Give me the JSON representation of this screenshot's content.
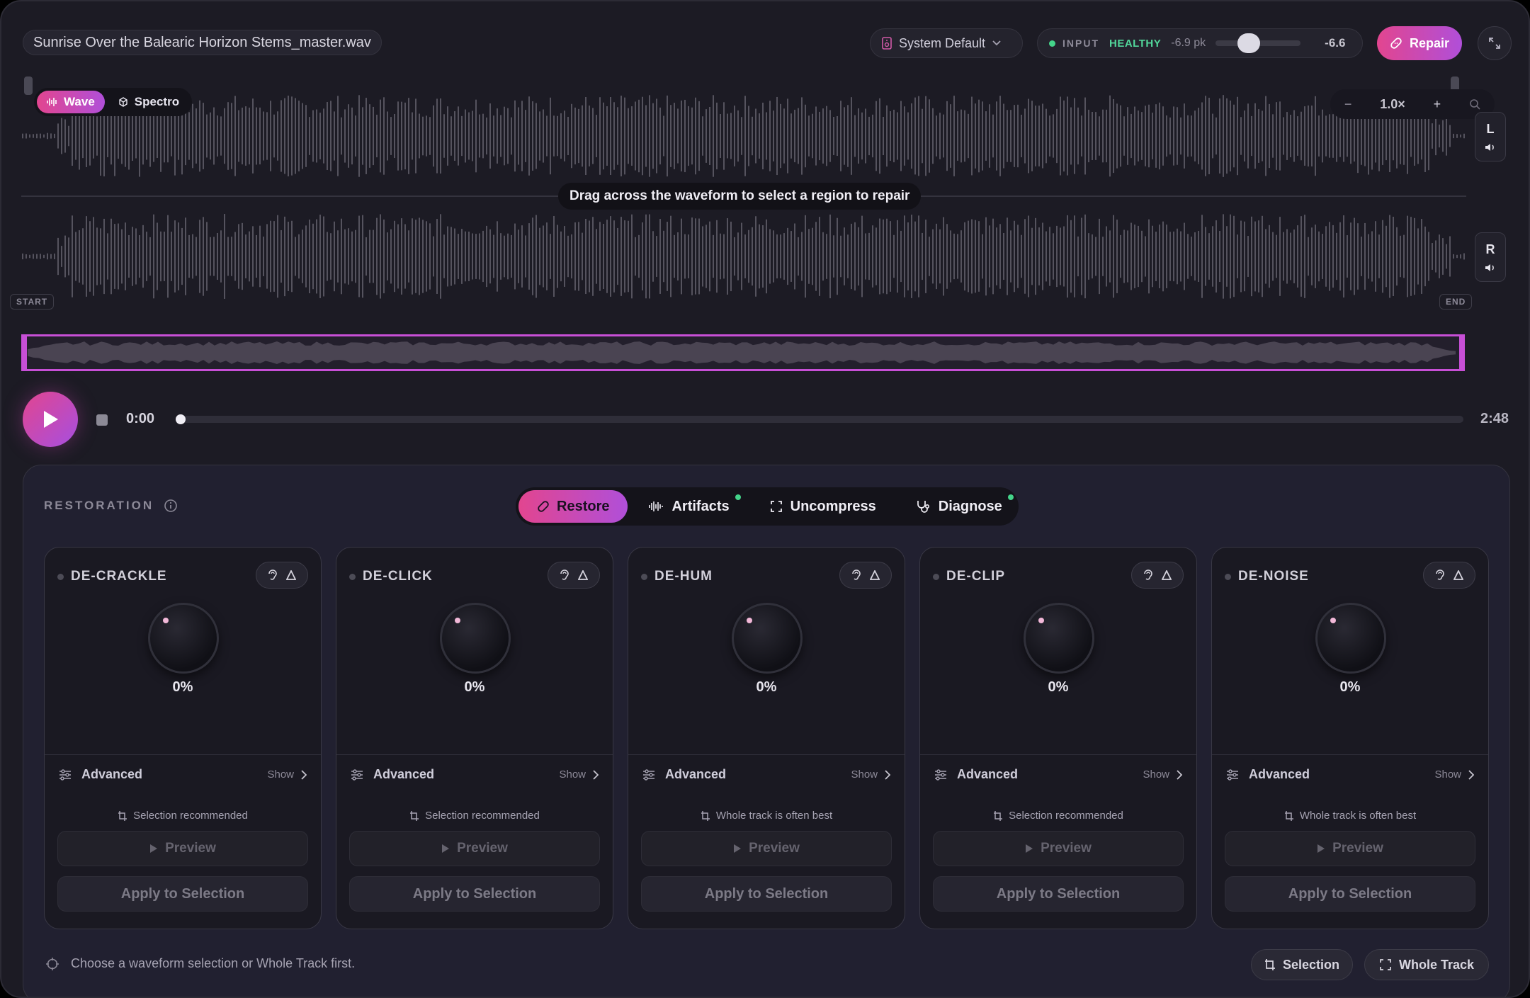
{
  "header": {
    "file_name": "Sunrise Over the Balearic Horizon Stems_master.wav",
    "device": "System Default",
    "meter": {
      "label": "INPUT",
      "status": "HEALTHY",
      "peak": "-6.9 pk",
      "gain_value": "-6.6",
      "gain_level": 0.35
    },
    "repair_label": "Repair"
  },
  "waveform": {
    "view_options": [
      "Wave",
      "Spectro"
    ],
    "active_view": "Wave",
    "zoom_level": "1.0×",
    "channels": [
      "L",
      "R"
    ],
    "hint": "Drag across the waveform to select a region to repair",
    "start_tag": "START",
    "end_tag": "END"
  },
  "transport": {
    "current_time": "0:00",
    "total_time": "2:48",
    "progress": 0
  },
  "restoration": {
    "label": "RESTORATION",
    "tabs": [
      {
        "label": "Restore",
        "active": true,
        "badge": false
      },
      {
        "label": "Artifacts",
        "active": false,
        "badge": true
      },
      {
        "label": "Uncompress",
        "active": false,
        "badge": false
      },
      {
        "label": "Diagnose",
        "active": false,
        "badge": true
      }
    ],
    "modules": [
      {
        "name": "DE-CRACKLE",
        "amount": "0%",
        "advanced": "Advanced",
        "show": "Show",
        "scope": "Selection recommended",
        "preview": "Preview",
        "apply": "Apply to Selection"
      },
      {
        "name": "DE-CLICK",
        "amount": "0%",
        "advanced": "Advanced",
        "show": "Show",
        "scope": "Selection recommended",
        "preview": "Preview",
        "apply": "Apply to Selection"
      },
      {
        "name": "DE-HUM",
        "amount": "0%",
        "advanced": "Advanced",
        "show": "Show",
        "scope": "Whole track is often best",
        "preview": "Preview",
        "apply": "Apply to Selection"
      },
      {
        "name": "DE-CLIP",
        "amount": "0%",
        "advanced": "Advanced",
        "show": "Show",
        "scope": "Selection recommended",
        "preview": "Preview",
        "apply": "Apply to Selection"
      },
      {
        "name": "DE-NOISE",
        "amount": "0%",
        "advanced": "Advanced",
        "show": "Show",
        "scope": "Whole track is often best",
        "preview": "Preview",
        "apply": "Apply to Selection"
      }
    ],
    "footer_note": "Choose a waveform selection or Whole Track first.",
    "scope_buttons": [
      "Selection",
      "Whole Track"
    ]
  },
  "colors": {
    "accent_pink": "#e2458f",
    "accent_purple": "#b04fd9",
    "healthy": "#52d69a",
    "background": "#1c1b24"
  }
}
